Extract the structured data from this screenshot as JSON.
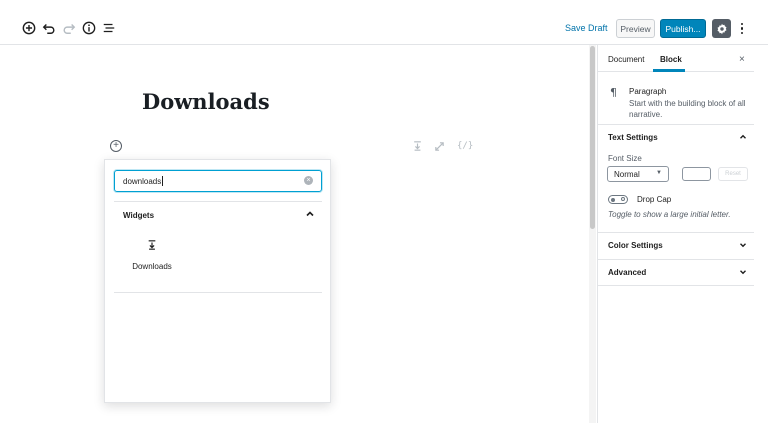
{
  "toolbar": {
    "save_draft_label": "Save Draft",
    "preview_label": "Preview",
    "publish_label": "Publish...",
    "accent_color": "#0085ba"
  },
  "post": {
    "title": "Downloads"
  },
  "block_toolbar": {
    "icons": [
      "download-icon",
      "expand-icon",
      "code-icon"
    ],
    "code_glyph": "{/}"
  },
  "inserter": {
    "search_value": "downloads",
    "panel_title": "Widgets",
    "results": [
      {
        "label": "Downloads",
        "icon": "download-icon"
      }
    ]
  },
  "sidebar": {
    "tabs": [
      {
        "label": "Document",
        "active": false
      },
      {
        "label": "Block",
        "active": true
      }
    ],
    "close_glyph": "×",
    "block": {
      "icon": "paragraph-icon",
      "icon_glyph": "¶",
      "title": "Paragraph",
      "description": "Start with the building block of all narrative."
    },
    "text_settings": {
      "title": "Text Settings",
      "font_size_label": "Font Size",
      "font_size_value": "Normal",
      "reset_label": "Reset",
      "drop_cap_label": "Drop Cap",
      "drop_cap_help": "Toggle to show a large initial letter."
    },
    "color_settings_title": "Color Settings",
    "advanced_title": "Advanced"
  }
}
